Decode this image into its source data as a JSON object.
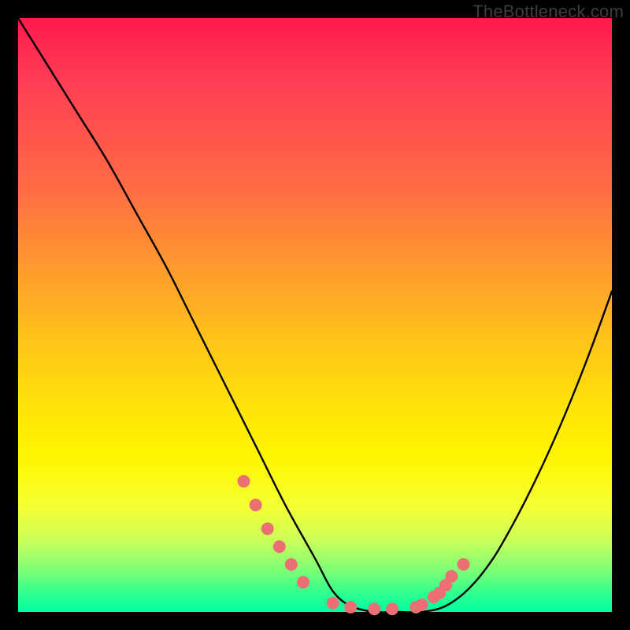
{
  "watermark": "TheBottleneck.com",
  "colors": {
    "frame": "#000000",
    "curve": "#000000",
    "dots": "#eb6f74",
    "gradient_stops": [
      "#ff1a4d",
      "#ff6a45",
      "#ffc518",
      "#fff500",
      "#7dff76",
      "#00ffa2"
    ]
  },
  "chart_data": {
    "type": "line",
    "title": "",
    "xlabel": "",
    "ylabel": "",
    "xlim": [
      0,
      100
    ],
    "ylim": [
      0,
      100
    ],
    "grid": false,
    "series": [
      {
        "name": "bottleneck-curve",
        "x": [
          0,
          5,
          10,
          15,
          20,
          25,
          30,
          35,
          40,
          45,
          50,
          53,
          56,
          60,
          64,
          68,
          72,
          76,
          80,
          84,
          88,
          92,
          96,
          100
        ],
        "values": [
          100,
          92,
          84,
          76,
          67,
          58,
          48,
          38,
          28,
          18,
          9,
          3.5,
          1,
          0,
          0,
          0,
          1,
          4,
          9,
          16,
          24,
          33,
          43,
          54
        ]
      }
    ],
    "highlight_points": {
      "name": "sampled-dots",
      "x": [
        38,
        40,
        42,
        44,
        46,
        48,
        53,
        56,
        60,
        63,
        67,
        68,
        70,
        71,
        72,
        73,
        75
      ],
      "values": [
        22,
        18,
        14,
        11,
        8,
        5,
        1.5,
        0.8,
        0.5,
        0.5,
        0.8,
        1.2,
        2.5,
        3.2,
        4.5,
        6,
        8
      ]
    },
    "annotations": []
  }
}
